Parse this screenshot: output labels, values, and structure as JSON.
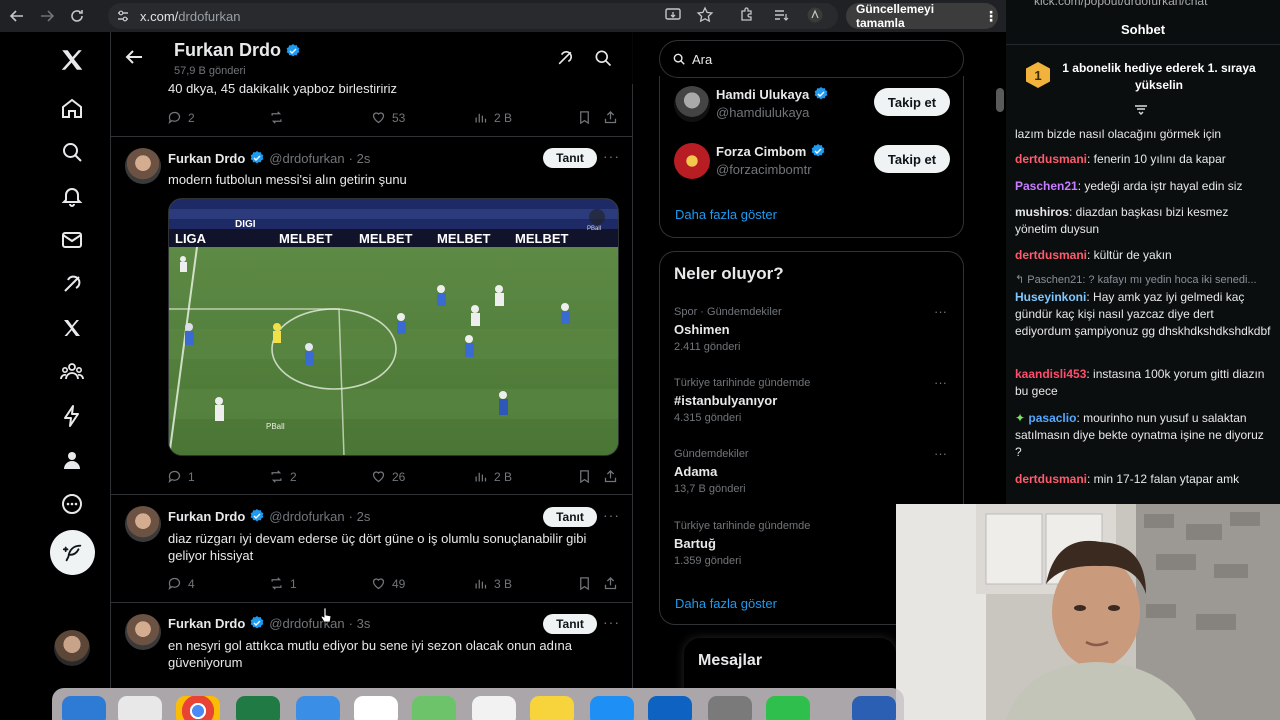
{
  "browser": {
    "url_host": "x.com/",
    "url_path": "drdofurkan",
    "update_label": "Güncellemeyi tamamla"
  },
  "profile": {
    "name": "Furkan Drdo",
    "post_count": "57,9 B gönderi"
  },
  "prev_tweet": {
    "text": "40 dkya, 45 dakikalık yapboz birlestiririz",
    "replies": "2",
    "likes": "53",
    "views": "2 B"
  },
  "tweets": [
    {
      "name": "Furkan Drdo",
      "handle": "@drdofurkan",
      "time": "· 2s",
      "tanit": "Tanıt",
      "text": "modern futbolun messi'si alın getirin şunu",
      "replies": "1",
      "reposts": "2",
      "likes": "26",
      "views": "2 B"
    },
    {
      "name": "Furkan Drdo",
      "handle": "@drdofurkan",
      "time": "· 2s",
      "tanit": "Tanıt",
      "text": "diaz rüzgarı iyi devam ederse üç dört güne o iş olumlu sonuçlanabilir gibi geliyor hissiyat",
      "replies": "4",
      "reposts": "1",
      "likes": "49",
      "views": "3 B"
    },
    {
      "name": "Furkan Drdo",
      "handle": "@drdofurkan",
      "time": "· 3s",
      "tanit": "Tanıt",
      "text": "en nesyri gol attıkca mutlu ediyor bu sene iyi sezon olacak onun adına güveniyorum"
    }
  ],
  "media": {
    "board1": "LIGA",
    "board2": "DIGI",
    "board3": "MELBET",
    "watermark": "PBall"
  },
  "search": {
    "placeholder": "Ara"
  },
  "who_to_follow": {
    "users": [
      {
        "name": "Hamdi Ulukaya",
        "handle": "@hamdiulukaya",
        "button": "Takip et"
      },
      {
        "name": "Forza Cimbom",
        "handle": "@forzacimbomtr",
        "button": "Takip et"
      }
    ],
    "show_more": "Daha fazla göster"
  },
  "trends": {
    "title": "Neler oluyor?",
    "items": [
      {
        "context": "Spor · Gündemdekiler",
        "topic": "Oshimen",
        "count": "2.411 gönderi"
      },
      {
        "context": "Türkiye tarihinde gündemde",
        "topic": "#istanbulyanıyor",
        "count": "4.315 gönderi"
      },
      {
        "context": "Gündemdekiler",
        "topic": "Adama",
        "count": "13,7 B gönderi"
      },
      {
        "context": "Türkiye tarihinde gündemde",
        "topic": "Bartuğ",
        "count": "1.359 gönderi"
      }
    ],
    "show_more": "Daha fazla göster"
  },
  "messages": {
    "title": "Mesajlar"
  },
  "kick": {
    "url": "kick.com/popout/drdofurkan/chat",
    "title": "Sohbet",
    "banner_level": "1",
    "banner_text": "1 abonelik hediye ederek 1. sıraya yükselin",
    "messages": [
      {
        "user": "",
        "text": "lazım bizde nasıl olacağını görmek için",
        "color": "#e8e8e8"
      },
      {
        "user": "dertdusmani",
        "text": ": fenerin 10 yılını da kapar",
        "color": "#ff5b6e"
      },
      {
        "user": "Paschen21",
        "text": ": yedeği arda iştr hayal edin siz",
        "color": "#c77dff"
      },
      {
        "user": "mushiros",
        "text": ": diazdan başkası bizi kesmez yönetim duysun",
        "color": "#e8e8e8"
      },
      {
        "user": "dertdusmani",
        "text": ": kültür de yakın",
        "color": "#ff5b6e"
      },
      {
        "user": "Huseyinkoni",
        "text": ": Hay amk yaz iyi gelmedi kaç gündür kaç kişi nasıl yazcaz diye dert ediyordum şampiyonuz gg dhskhdkshdkshdkdbf",
        "color": "#7ec8ff",
        "reply": "Paschen21: ? kafayı mı yedin hoca iki senedi..."
      },
      {
        "user": "kaandisli453",
        "text": ": instasına 100k yorum gitti diazın bu gece",
        "color": "#ff4d6d"
      },
      {
        "user": "pasaclio",
        "text": ": mourinho nun yusuf u salaktan satılmasın diye bekte oynatma işine ne diyoruz ?",
        "color": "#53a8ff"
      },
      {
        "user": "dertdusmani",
        "text": ": min 17-12 falan ytapar amk",
        "color": "#ff5b6e"
      }
    ]
  },
  "colors": {
    "accent": "#1d9bf0",
    "verified": "#1d9bf0",
    "bg": "#000000",
    "border": "#2f3336"
  }
}
